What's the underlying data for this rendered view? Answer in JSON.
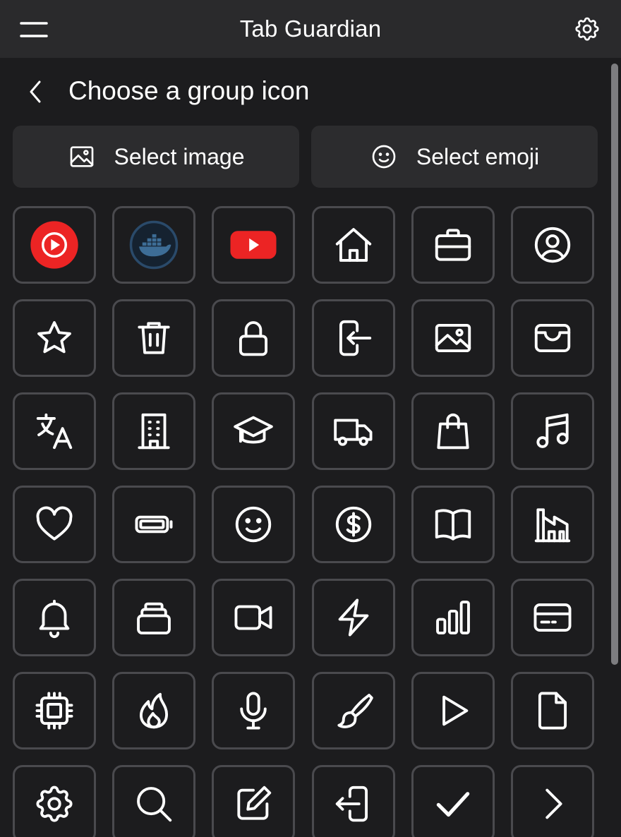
{
  "header": {
    "title": "Tab Guardian",
    "menu_icon": "hamburger-menu-icon",
    "settings_icon": "gear-icon"
  },
  "picker": {
    "title": "Choose a group icon",
    "back_icon": "chevron-left-icon",
    "select_image_label": "Select image",
    "select_image_icon": "image-icon",
    "select_emoji_label": "Select emoji",
    "select_emoji_icon": "smiley-icon"
  },
  "icons": [
    "youtube-music-icon",
    "docker-icon",
    "youtube-icon",
    "home-icon",
    "briefcase-icon",
    "user-circle-icon",
    "star-icon",
    "trash-icon",
    "lock-icon",
    "login-icon",
    "image-icon",
    "wallet-icon",
    "translate-icon",
    "building-icon",
    "graduation-cap-icon",
    "truck-icon",
    "shopping-bag-icon",
    "music-note-icon",
    "heart-icon",
    "battery-icon",
    "smiley-icon",
    "dollar-circle-icon",
    "book-open-icon",
    "factory-icon",
    "bell-icon",
    "stack-icon",
    "video-camera-icon",
    "lightning-icon",
    "bar-chart-icon",
    "credit-card-icon",
    "cpu-chip-icon",
    "fire-icon",
    "microphone-icon",
    "paintbrush-icon",
    "play-icon",
    "file-icon",
    "gear-icon",
    "search-icon",
    "edit-icon",
    "logout-icon",
    "checkmark-icon",
    "chevron-right-icon"
  ],
  "colors": {
    "background": "#1c1c1e",
    "header": "#2a2a2c",
    "button": "#2c2c2e",
    "cell_border": "#4a4a4e",
    "youtube_red": "#ec2424",
    "docker_navy": "#1f3550"
  }
}
